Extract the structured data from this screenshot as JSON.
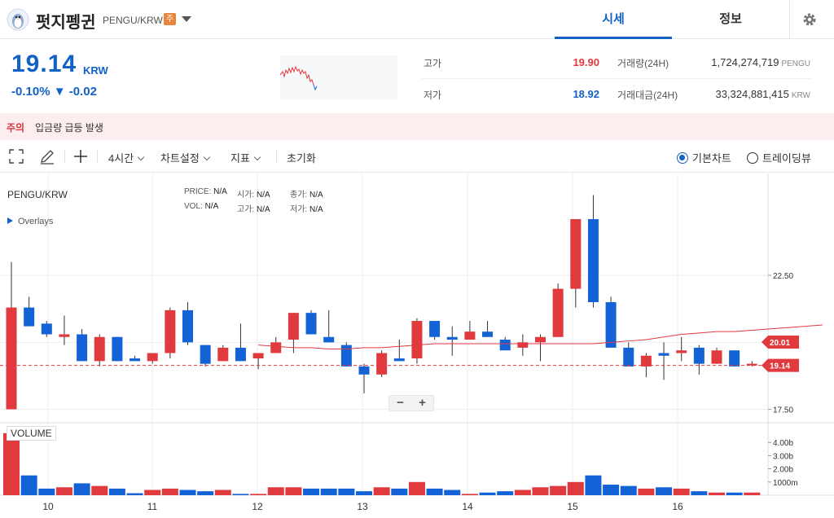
{
  "header": {
    "coin_name": "펏지펭귄",
    "pair": "PENGU/KRW",
    "caution_badge": "주",
    "tabs": [
      "시세",
      "정보"
    ]
  },
  "summary": {
    "price": "19.14",
    "unit": "KRW",
    "change_pct": "-0.10%",
    "change_abs": "▼ -0.02",
    "high_label": "고가",
    "high_value": "19.90",
    "low_label": "저가",
    "low_value": "18.92",
    "volume_label": "거래량(24H)",
    "volume_value": "1,724,274,719",
    "volume_unit": "PENGU",
    "amount_label": "거래대금(24H)",
    "amount_value": "33,324,881,415",
    "amount_unit": "KRW"
  },
  "warning": {
    "tag": "주의",
    "text": "입금량 급등 발생"
  },
  "toolbar": {
    "interval": "4시간",
    "chart_settings": "차트설정",
    "indicators": "지표",
    "reset": "초기화",
    "mode_basic": "기본차트",
    "mode_tv": "트레이딩뷰"
  },
  "chart": {
    "symbol": "PENGU/KRW",
    "overlays": "Overlays",
    "ohlc": {
      "price_label": "PRICE:",
      "price_val": "N/A",
      "open_label": "시가:",
      "open_val": "N/A",
      "close_label": "종가:",
      "close_val": "N/A",
      "vol_label": "VOL:",
      "vol_val": "N/A",
      "high_label": "고가:",
      "high_val": "N/A",
      "low_label": "저가:",
      "low_val": "N/A"
    },
    "zoom_out": "−",
    "zoom_in": "+",
    "volume_label": "VOLUME",
    "colors": {
      "up": "#e0393e",
      "down": "#1463d6",
      "ma": "#e0393e",
      "grid": "#eceef1"
    }
  },
  "chart_data": {
    "type": "candlestick",
    "x_ticks": [
      "10",
      "11",
      "12",
      "13",
      "14",
      "15",
      "16"
    ],
    "y_ticks": [
      "22.50",
      "17.50"
    ],
    "volume_ticks": [
      "4.00b",
      "3.00b",
      "2.00b",
      "1000m"
    ],
    "current_price_label": "19.14",
    "ma_label": "20.01",
    "candles": [
      {
        "o": 17.5,
        "h": 23.0,
        "l": 17.5,
        "c": 21.3,
        "up": true
      },
      {
        "o": 21.3,
        "h": 21.7,
        "l": 20.6,
        "c": 20.6,
        "up": false
      },
      {
        "o": 20.7,
        "h": 20.8,
        "l": 20.2,
        "c": 20.3,
        "up": false
      },
      {
        "o": 20.2,
        "h": 21.0,
        "l": 19.9,
        "c": 20.3,
        "up": true
      },
      {
        "o": 20.3,
        "h": 20.5,
        "l": 19.3,
        "c": 19.3,
        "up": false
      },
      {
        "o": 19.3,
        "h": 20.3,
        "l": 19.1,
        "c": 20.2,
        "up": true
      },
      {
        "o": 20.2,
        "h": 20.2,
        "l": 19.3,
        "c": 19.3,
        "up": false
      },
      {
        "o": 19.4,
        "h": 19.5,
        "l": 19.3,
        "c": 19.3,
        "up": false
      },
      {
        "o": 19.3,
        "h": 19.6,
        "l": 19.2,
        "c": 19.6,
        "up": true
      },
      {
        "o": 19.6,
        "h": 21.3,
        "l": 19.4,
        "c": 21.2,
        "up": true
      },
      {
        "o": 21.2,
        "h": 21.5,
        "l": 19.9,
        "c": 20.0,
        "up": false
      },
      {
        "o": 19.9,
        "h": 19.9,
        "l": 19.1,
        "c": 19.2,
        "up": false
      },
      {
        "o": 19.3,
        "h": 19.9,
        "l": 19.3,
        "c": 19.8,
        "up": true
      },
      {
        "o": 19.8,
        "h": 20.7,
        "l": 19.3,
        "c": 19.3,
        "up": false
      },
      {
        "o": 19.4,
        "h": 19.6,
        "l": 19.0,
        "c": 19.6,
        "up": true
      },
      {
        "o": 19.6,
        "h": 20.2,
        "l": 19.6,
        "c": 20.0,
        "up": true
      },
      {
        "o": 20.1,
        "h": 21.1,
        "l": 19.6,
        "c": 21.1,
        "up": true
      },
      {
        "o": 21.1,
        "h": 21.2,
        "l": 20.3,
        "c": 20.3,
        "up": false
      },
      {
        "o": 20.2,
        "h": 21.2,
        "l": 20.0,
        "c": 20.0,
        "up": false
      },
      {
        "o": 19.9,
        "h": 20.0,
        "l": 19.1,
        "c": 19.1,
        "up": false
      },
      {
        "o": 19.1,
        "h": 19.2,
        "l": 18.1,
        "c": 18.8,
        "up": false
      },
      {
        "o": 18.8,
        "h": 19.7,
        "l": 18.7,
        "c": 19.6,
        "up": true
      },
      {
        "o": 19.4,
        "h": 20.1,
        "l": 19.3,
        "c": 19.3,
        "up": false
      },
      {
        "o": 19.4,
        "h": 20.9,
        "l": 19.2,
        "c": 20.8,
        "up": true
      },
      {
        "o": 20.8,
        "h": 20.8,
        "l": 20.1,
        "c": 20.2,
        "up": false
      },
      {
        "o": 20.2,
        "h": 20.6,
        "l": 19.5,
        "c": 20.1,
        "up": false
      },
      {
        "o": 20.1,
        "h": 20.8,
        "l": 20.1,
        "c": 20.4,
        "up": true
      },
      {
        "o": 20.4,
        "h": 20.8,
        "l": 20.2,
        "c": 20.2,
        "up": false
      },
      {
        "o": 20.1,
        "h": 20.2,
        "l": 19.7,
        "c": 19.7,
        "up": false
      },
      {
        "o": 19.8,
        "h": 20.3,
        "l": 19.5,
        "c": 20.0,
        "up": true
      },
      {
        "o": 20.0,
        "h": 20.3,
        "l": 19.3,
        "c": 20.2,
        "up": true
      },
      {
        "o": 20.2,
        "h": 22.2,
        "l": 20.2,
        "c": 22.0,
        "up": true
      },
      {
        "o": 22.0,
        "h": 24.6,
        "l": 21.3,
        "c": 24.6,
        "up": true
      },
      {
        "o": 24.6,
        "h": 25.5,
        "l": 21.3,
        "c": 21.5,
        "up": false
      },
      {
        "o": 21.5,
        "h": 21.7,
        "l": 19.8,
        "c": 19.8,
        "up": false
      },
      {
        "o": 19.8,
        "h": 20.0,
        "l": 19.1,
        "c": 19.1,
        "up": false
      },
      {
        "o": 19.1,
        "h": 19.6,
        "l": 18.7,
        "c": 19.5,
        "up": true
      },
      {
        "o": 19.6,
        "h": 20.0,
        "l": 18.6,
        "c": 19.5,
        "up": false
      },
      {
        "o": 19.6,
        "h": 20.2,
        "l": 19.3,
        "c": 19.7,
        "up": true
      },
      {
        "o": 19.8,
        "h": 19.9,
        "l": 18.8,
        "c": 19.2,
        "up": false
      },
      {
        "o": 19.2,
        "h": 19.8,
        "l": 19.2,
        "c": 19.7,
        "up": true
      },
      {
        "o": 19.7,
        "h": 19.7,
        "l": 19.1,
        "c": 19.1,
        "up": false
      },
      {
        "o": 19.2,
        "h": 19.3,
        "l": 19.1,
        "c": 19.2,
        "up": true
      }
    ],
    "ma": [
      19.9,
      19.85,
      19.8,
      19.8,
      19.75,
      19.75,
      19.8,
      19.8,
      19.85,
      19.9,
      19.95,
      19.95,
      19.95,
      19.95,
      19.95,
      19.95,
      19.95,
      19.95,
      19.95,
      19.95,
      20.0,
      20.05,
      20.1,
      20.2,
      20.3,
      20.35,
      20.4,
      20.4,
      20.45,
      20.5,
      20.55,
      20.6,
      20.65
    ],
    "volumes": [
      4.7,
      1.5,
      0.5,
      0.6,
      0.9,
      0.7,
      0.5,
      0.15,
      0.4,
      0.5,
      0.4,
      0.3,
      0.4,
      0.1,
      0.1,
      0.6,
      0.6,
      0.5,
      0.5,
      0.5,
      0.3,
      0.6,
      0.5,
      1.0,
      0.5,
      0.4,
      0.1,
      0.2,
      0.3,
      0.4,
      0.6,
      0.7,
      1.0,
      1.5,
      0.8,
      0.7,
      0.5,
      0.6,
      0.5,
      0.3,
      0.2,
      0.2,
      0.2
    ],
    "ylim": [
      17.0,
      26.0
    ],
    "volume_max": 5.0
  }
}
